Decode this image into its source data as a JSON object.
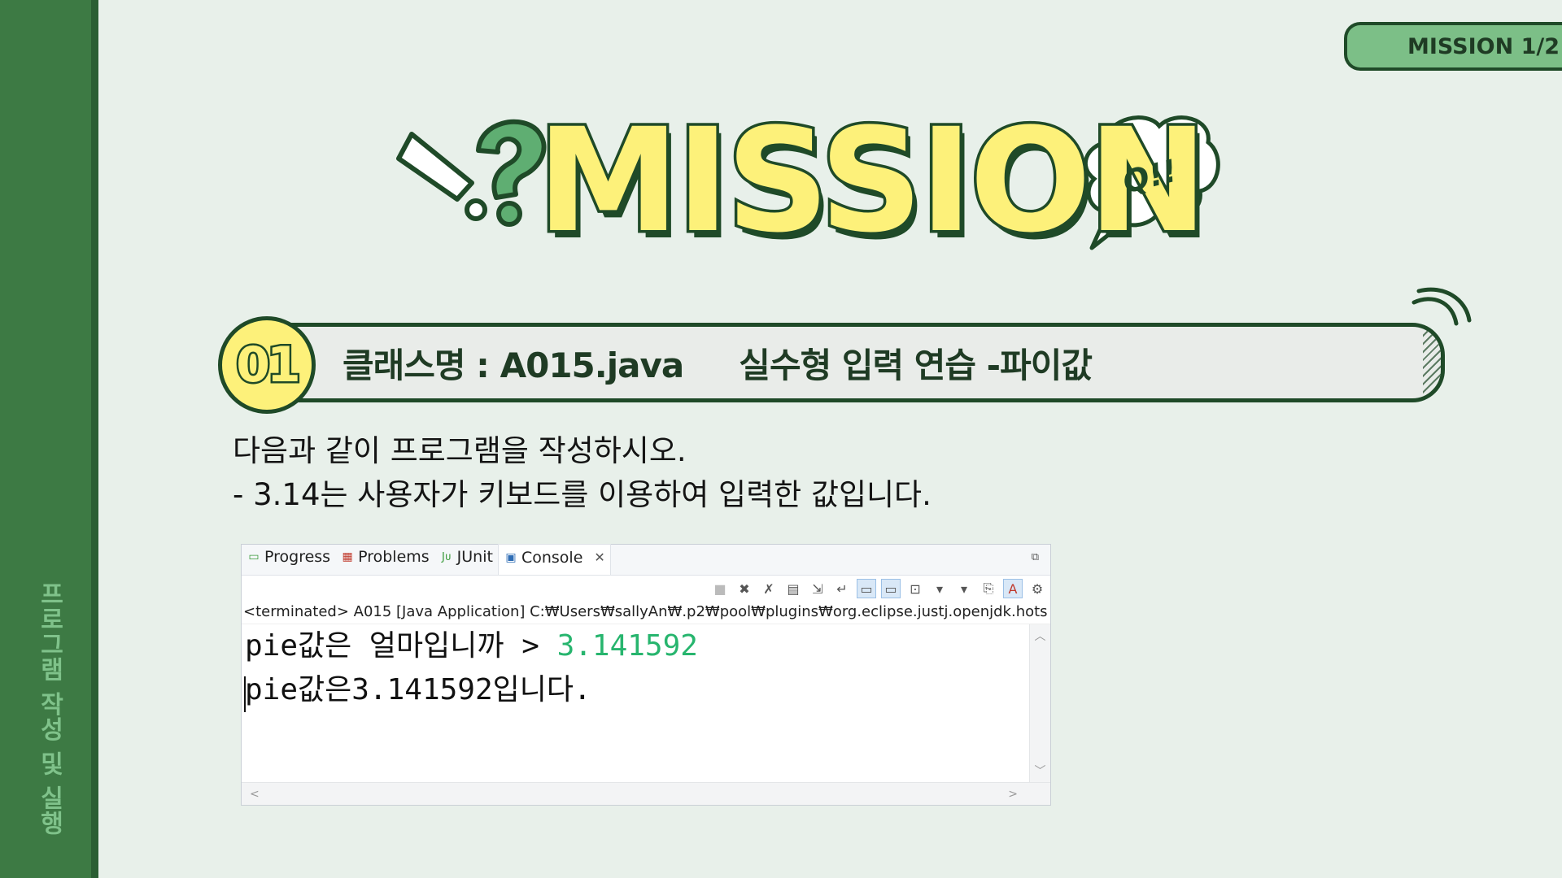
{
  "sidebar": {
    "text": "프로그램 작성 및 실행"
  },
  "badge": {
    "text": "MISSION  1/2"
  },
  "title": {
    "text": "MISSION",
    "bubble_text": "Q!!"
  },
  "heading": {
    "number": "01",
    "text": "클래스명 : A015.java     실수형 입력 연습 -파이값"
  },
  "instructions": {
    "line1": "다음과 같이 프로그램을 작성하시오.",
    "line2": "- 3.14는 사용자가 키보드를 이용하여 입력한 값입니다."
  },
  "console": {
    "tabs": [
      {
        "label": "Progress",
        "icon": "progress-icon"
      },
      {
        "label": "Problems",
        "icon": "problems-icon"
      },
      {
        "label": "JUnit",
        "icon": "junit-icon"
      },
      {
        "label": "Console",
        "icon": "console-icon",
        "active": true
      }
    ],
    "status": "<terminated> A015 [Java Application] C:₩Users₩sallyAn₩.p2₩pool₩plugins₩org.eclipse.justj.openjdk.hots",
    "output_line1_prompt": "pie값은 얼마입니까 > ",
    "output_line1_input": "3.141592",
    "output_line2": "pie값은3.141592입니다."
  },
  "colors": {
    "background": "#e8f0ea",
    "sidebar": "#3d7a44",
    "accent_dark": "#1f4a28",
    "title_fill": "#fdf17a",
    "input_green": "#27b56e"
  }
}
